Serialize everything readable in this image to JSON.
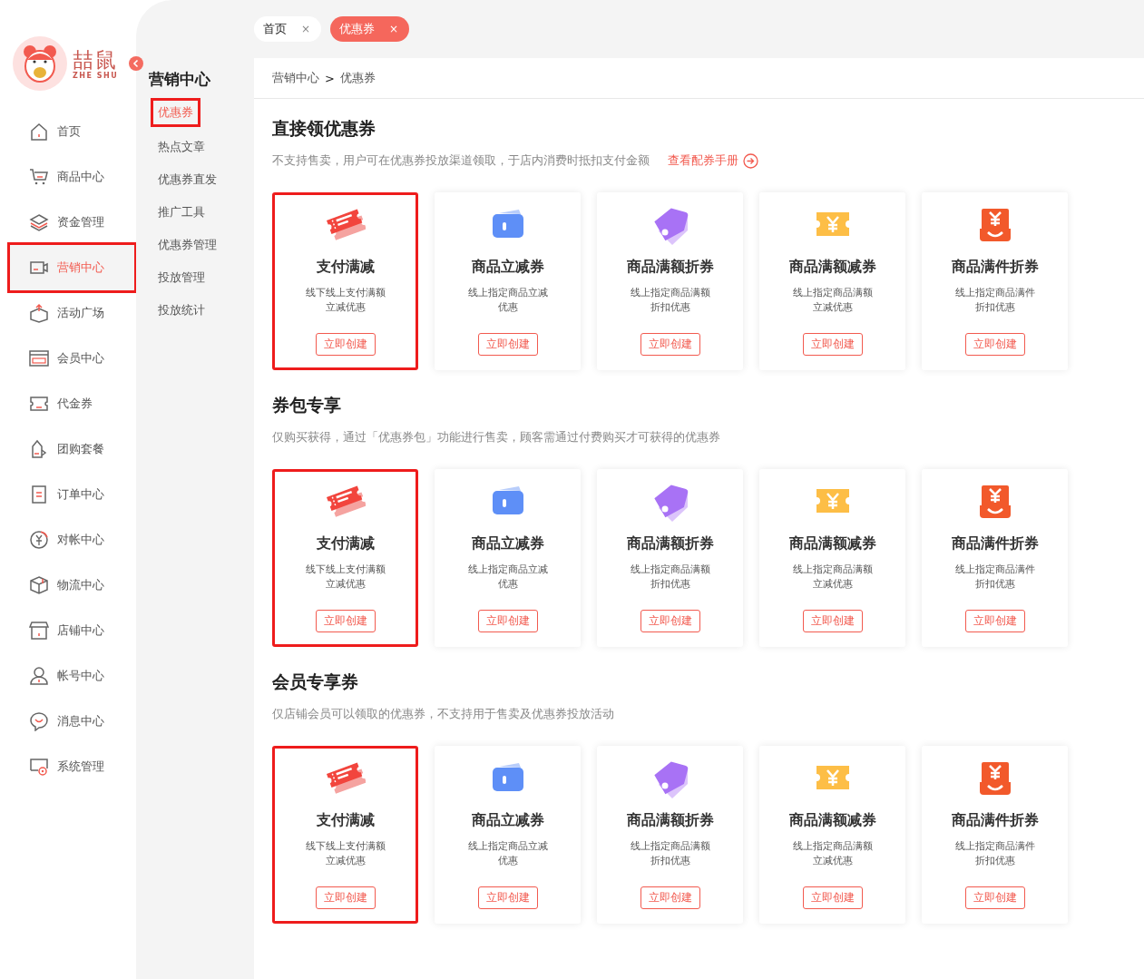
{
  "logo": {
    "name": "喆鼠",
    "pinyin": "ZHE SHU"
  },
  "sidebar": {
    "items": [
      {
        "label": "首页",
        "selected": false,
        "highlighted": false
      },
      {
        "label": "商品中心",
        "selected": false,
        "highlighted": false
      },
      {
        "label": "资金管理",
        "selected": false,
        "highlighted": false
      },
      {
        "label": "营销中心",
        "selected": true,
        "highlighted": true
      },
      {
        "label": "活动广场",
        "selected": false,
        "highlighted": false
      },
      {
        "label": "会员中心",
        "selected": false,
        "highlighted": false
      },
      {
        "label": "代金券",
        "selected": false,
        "highlighted": false
      },
      {
        "label": "团购套餐",
        "selected": false,
        "highlighted": false
      },
      {
        "label": "订单中心",
        "selected": false,
        "highlighted": false
      },
      {
        "label": "对帐中心",
        "selected": false,
        "highlighted": false
      },
      {
        "label": "物流中心",
        "selected": false,
        "highlighted": false
      },
      {
        "label": "店铺中心",
        "selected": false,
        "highlighted": false
      },
      {
        "label": "帐号中心",
        "selected": false,
        "highlighted": false
      },
      {
        "label": "消息中心",
        "selected": false,
        "highlighted": false
      },
      {
        "label": "系统管理",
        "selected": false,
        "highlighted": false
      }
    ]
  },
  "submenu": {
    "title": "营销中心",
    "items": [
      {
        "label": "优惠券",
        "selected": true,
        "highlighted": true
      },
      {
        "label": "热点文章",
        "selected": false,
        "highlighted": false
      },
      {
        "label": "优惠券直发",
        "selected": false,
        "highlighted": false
      },
      {
        "label": "推广工具",
        "selected": false,
        "highlighted": false
      },
      {
        "label": "优惠券管理",
        "selected": false,
        "highlighted": false
      },
      {
        "label": "投放管理",
        "selected": false,
        "highlighted": false
      },
      {
        "label": "投放统计",
        "selected": false,
        "highlighted": false
      }
    ]
  },
  "tabs": [
    {
      "label": "首页",
      "close": "×",
      "selected": false
    },
    {
      "label": "优惠券",
      "close": "×",
      "selected": true
    }
  ],
  "breadcrumb": {
    "parent": "营销中心",
    "separator": ">",
    "current": "优惠券"
  },
  "sections": [
    {
      "title": "直接领优惠券",
      "description": "不支持售卖，用户可在优惠券投放渠道领取，于店内消费时抵扣支付金额",
      "link": "查看配券手册",
      "cards": [
        {
          "kind": "ticket",
          "title": "支付满减",
          "lines": [
            "线下线上支付满额",
            "立减优惠"
          ],
          "button": "立即创建",
          "highlighted": true
        },
        {
          "kind": "wallet",
          "title": "商品立减券",
          "lines": [
            "线上指定商品立减",
            "优惠"
          ],
          "button": "立即创建",
          "highlighted": false
        },
        {
          "kind": "tag",
          "title": "商品满额折券",
          "lines": [
            "线上指定商品满额",
            "折扣优惠"
          ],
          "button": "立即创建",
          "highlighted": false
        },
        {
          "kind": "yen-ticket",
          "title": "商品满额减券",
          "lines": [
            "线上指定商品满额",
            "立减优惠"
          ],
          "button": "立即创建",
          "highlighted": false
        },
        {
          "kind": "yen-bag",
          "title": "商品满件折券",
          "lines": [
            "线上指定商品满件",
            "折扣优惠"
          ],
          "button": "立即创建",
          "highlighted": false
        }
      ]
    },
    {
      "title": "券包专享",
      "description": "仅购买获得，通过「优惠券包」功能进行售卖，顾客需通过付费购买才可获得的优惠券",
      "cards": [
        {
          "kind": "ticket",
          "title": "支付满减",
          "lines": [
            "线下线上支付满额",
            "立减优惠"
          ],
          "button": "立即创建",
          "highlighted": true
        },
        {
          "kind": "wallet",
          "title": "商品立减券",
          "lines": [
            "线上指定商品立减",
            "优惠"
          ],
          "button": "立即创建",
          "highlighted": false
        },
        {
          "kind": "tag",
          "title": "商品满额折券",
          "lines": [
            "线上指定商品满额",
            "折扣优惠"
          ],
          "button": "立即创建",
          "highlighted": false
        },
        {
          "kind": "yen-ticket",
          "title": "商品满额减券",
          "lines": [
            "线上指定商品满额",
            "立减优惠"
          ],
          "button": "立即创建",
          "highlighted": false
        },
        {
          "kind": "yen-bag",
          "title": "商品满件折券",
          "lines": [
            "线上指定商品满件",
            "折扣优惠"
          ],
          "button": "立即创建",
          "highlighted": false
        }
      ]
    },
    {
      "title": "会员专享券",
      "description": "仅店铺会员可以领取的优惠券，不支持用于售卖及优惠券投放活动",
      "cards": [
        {
          "kind": "ticket",
          "title": "支付满减",
          "lines": [
            "线下线上支付满额",
            "立减优惠"
          ],
          "button": "立即创建",
          "highlighted": true
        },
        {
          "kind": "wallet",
          "title": "商品立减券",
          "lines": [
            "线上指定商品立减",
            "优惠"
          ],
          "button": "立即创建",
          "highlighted": false
        },
        {
          "kind": "tag",
          "title": "商品满额折券",
          "lines": [
            "线上指定商品满额",
            "折扣优惠"
          ],
          "button": "立即创建",
          "highlighted": false
        },
        {
          "kind": "yen-ticket",
          "title": "商品满额减券",
          "lines": [
            "线上指定商品满额",
            "立减优惠"
          ],
          "button": "立即创建",
          "highlighted": false
        },
        {
          "kind": "yen-bag",
          "title": "商品满件折券",
          "lines": [
            "线上指定商品满件",
            "折扣优惠"
          ],
          "button": "立即创建",
          "highlighted": false
        }
      ]
    }
  ]
}
